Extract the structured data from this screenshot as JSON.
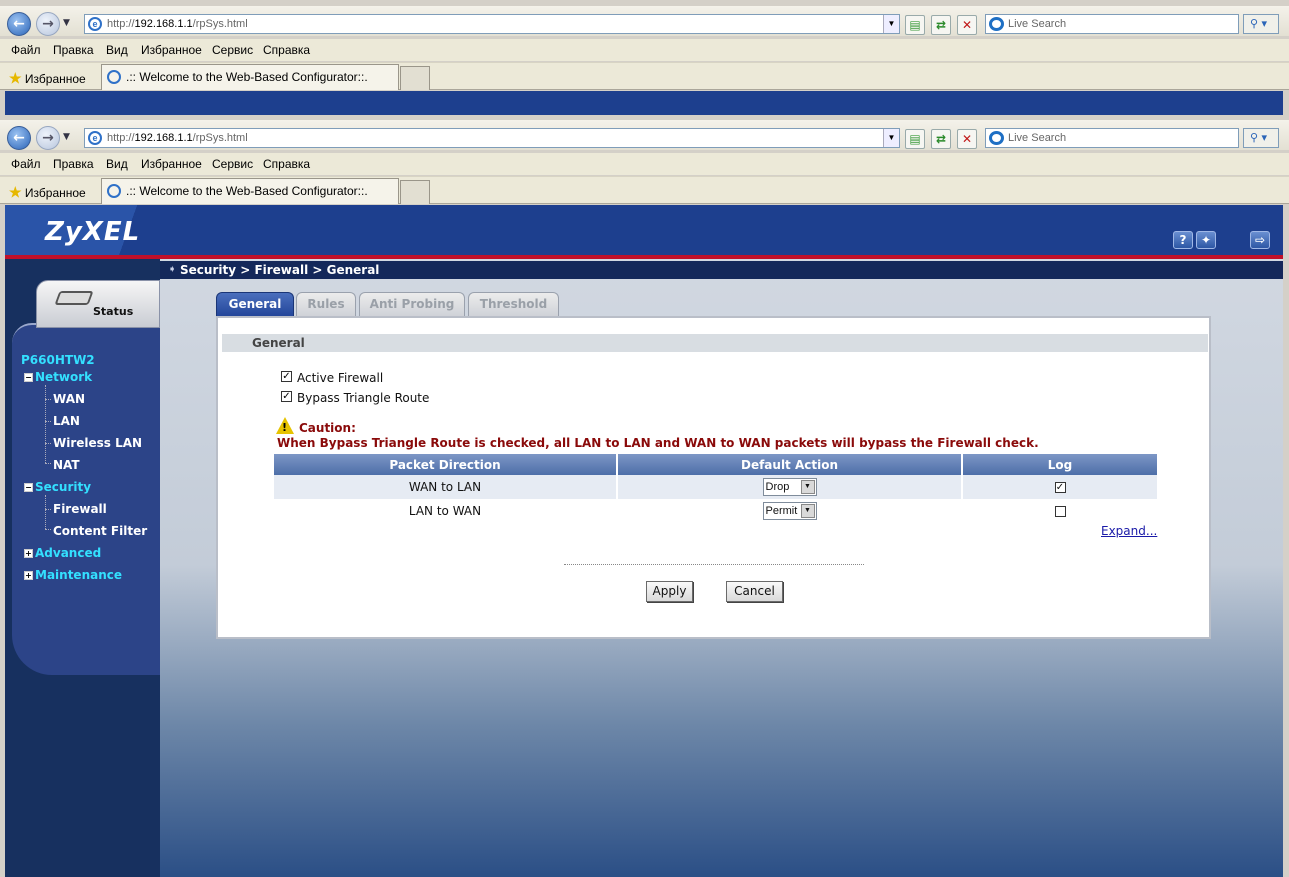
{
  "browser": {
    "url_prefix": "http://",
    "url_host": "192.168.1.1",
    "url_path": "/rpSys.html",
    "search_placeholder": "Live Search",
    "menu": [
      "Файл",
      "Правка",
      "Вид",
      "Избранное",
      "Сервис",
      "Справка"
    ],
    "favorites_label": "Избранное",
    "tab_title": ".:: Welcome to the Web-Based Configurator::."
  },
  "header": {
    "logo": "ZyXEL",
    "help_icon": "?",
    "wizard_icon": "wizard-icon",
    "logout_icon": "logout-icon"
  },
  "sidebar": {
    "status_label": "Status",
    "device": "P660HTW2",
    "network": "Network",
    "network_items": [
      "WAN",
      "LAN",
      "Wireless LAN",
      "NAT"
    ],
    "security": "Security",
    "security_items": [
      "Firewall",
      "Content Filter"
    ],
    "advanced": "Advanced",
    "maintenance": "Maintenance"
  },
  "breadcrumb": "Security > Firewall > General",
  "tabs": [
    "General",
    "Rules",
    "Anti Probing",
    "Threshold"
  ],
  "section_title": "General",
  "options": {
    "active_firewall": "Active Firewall",
    "bypass_triangle": "Bypass Triangle Route"
  },
  "caution": {
    "title": "Caution:",
    "text": "When Bypass Triangle Route is checked, all LAN to LAN and WAN to WAN packets will bypass the Firewall check."
  },
  "table": {
    "headers": [
      "Packet Direction",
      "Default Action",
      "Log"
    ],
    "rows": [
      {
        "direction": "WAN to LAN",
        "action": "Drop",
        "log": true
      },
      {
        "direction": "LAN to WAN",
        "action": "Permit",
        "log": false
      }
    ]
  },
  "expand": "Expand...",
  "buttons": {
    "apply": "Apply",
    "cancel": "Cancel"
  },
  "colors": {
    "brand_blue": "#1d3f8e",
    "accent_red": "#c0102a",
    "nav_cyan": "#33e0ff",
    "caution_red": "#8a0a0a"
  }
}
